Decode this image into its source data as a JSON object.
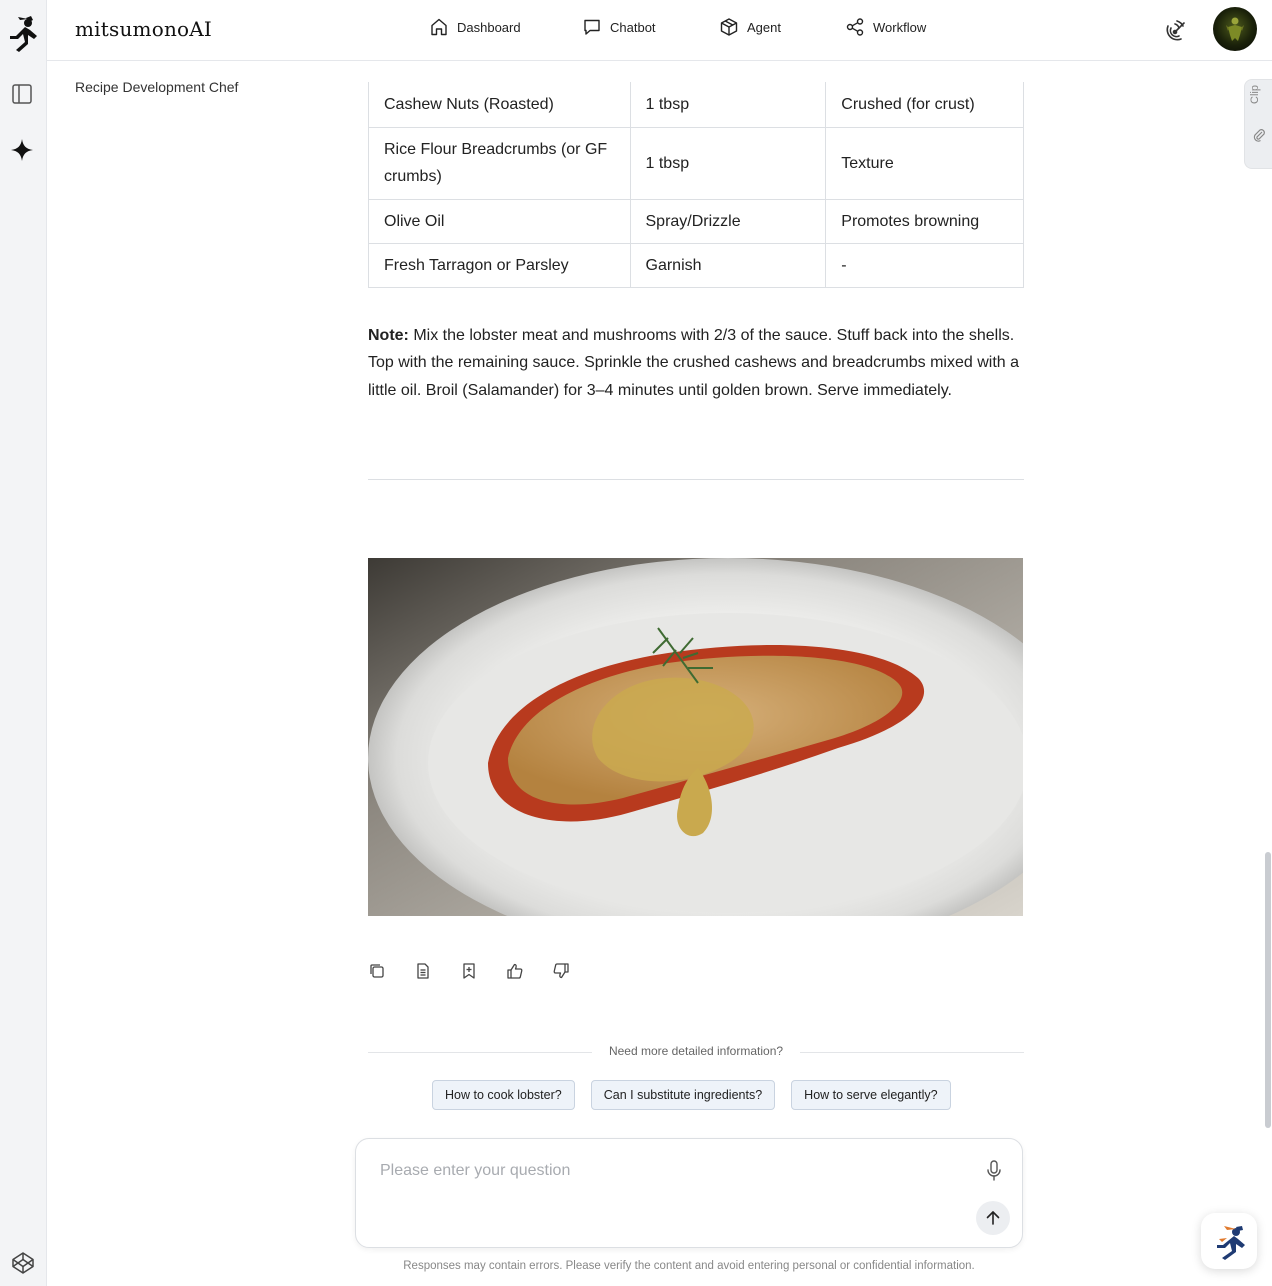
{
  "app": {
    "brand": "mitsumonoAI"
  },
  "nav": {
    "dashboard": "Dashboard",
    "chatbot": "Chatbot",
    "agent": "Agent",
    "workflow": "Workflow"
  },
  "page": {
    "subtitle": "Recipe Development Chef"
  },
  "clip": {
    "label": "Clip"
  },
  "table": {
    "rows": [
      [
        "Cashew Nuts (Roasted)",
        "1 tbsp",
        "Crushed (for crust)"
      ],
      [
        "Rice Flour Breadcrumbs (or GF crumbs)",
        "1 tbsp",
        "Texture"
      ],
      [
        "Olive Oil",
        "Spray/Drizzle",
        "Promotes browning"
      ],
      [
        "Fresh Tarragon or Parsley",
        "Garnish",
        "-"
      ]
    ]
  },
  "note": {
    "label": "Note:",
    "text": " Mix the lobster meat and mushrooms with 2/3 of the sauce. Stuff back into the shells. Top with the remaining sauce. Sprinkle the crushed cashews and breadcrumbs mixed with a little oil. Broil (Salamander) for 3–4 minutes until golden brown. Serve immediately."
  },
  "actions": [
    "copy-icon",
    "document-icon",
    "bookmark-icon",
    "thumbs-up-icon",
    "thumbs-down-icon"
  ],
  "more_info": {
    "label": "Need more detailed information?"
  },
  "suggestions": [
    "How to cook lobster?",
    "Can I substitute ingredients?",
    "How to serve elegantly?"
  ],
  "input": {
    "placeholder": "Please enter your question",
    "value": ""
  },
  "disclaimer": "Responses may contain errors. Please verify the content and avoid entering personal or confidential information.",
  "colors": {
    "chip_bg": "#eef3f9",
    "chip_border": "#c9d3e0",
    "rail_bg": "#f3f4f6"
  }
}
